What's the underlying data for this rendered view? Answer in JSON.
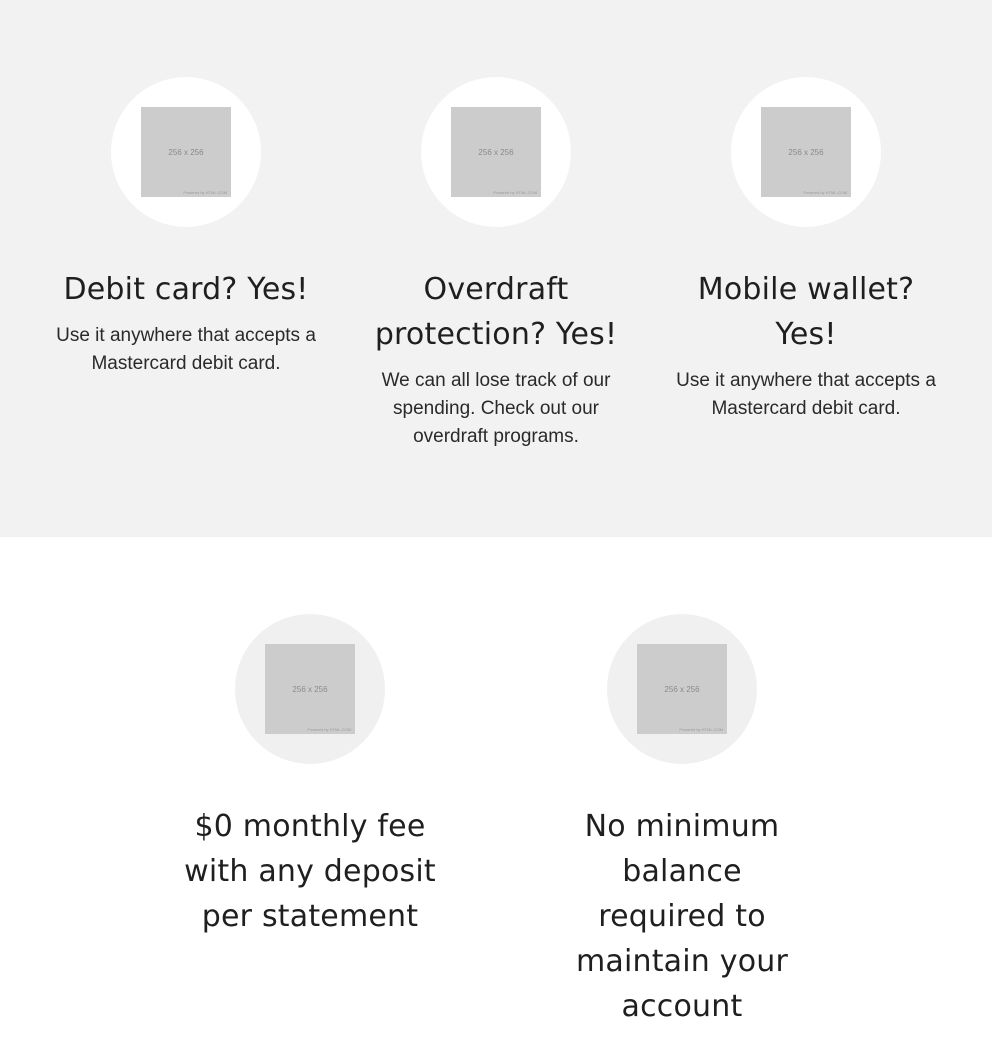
{
  "top_features": [
    {
      "image_size_label": "256 x 256",
      "image_credit": "Powered by HTML.COM",
      "title": "Debit card? Yes!",
      "description": "Use it anywhere that accepts a Mastercard debit card."
    },
    {
      "image_size_label": "256 x 256",
      "image_credit": "Powered by HTML.COM",
      "title": "Overdraft protection? Yes!",
      "description": "We can all lose track of our spending. Check out our overdraft programs."
    },
    {
      "image_size_label": "256 x 256",
      "image_credit": "Powered by HTML.COM",
      "title": "Mobile wallet? Yes!",
      "description": "Use it anywhere that accepts a Mastercard debit card."
    }
  ],
  "bottom_features": [
    {
      "image_size_label": "256 x 256",
      "image_credit": "Powered by HTML.COM",
      "title": "$0 monthly fee with any deposit per statement"
    },
    {
      "image_size_label": "256 x 256",
      "image_credit": "Powered by HTML.COM",
      "title": "No minimum balance required to maintain your account"
    }
  ]
}
